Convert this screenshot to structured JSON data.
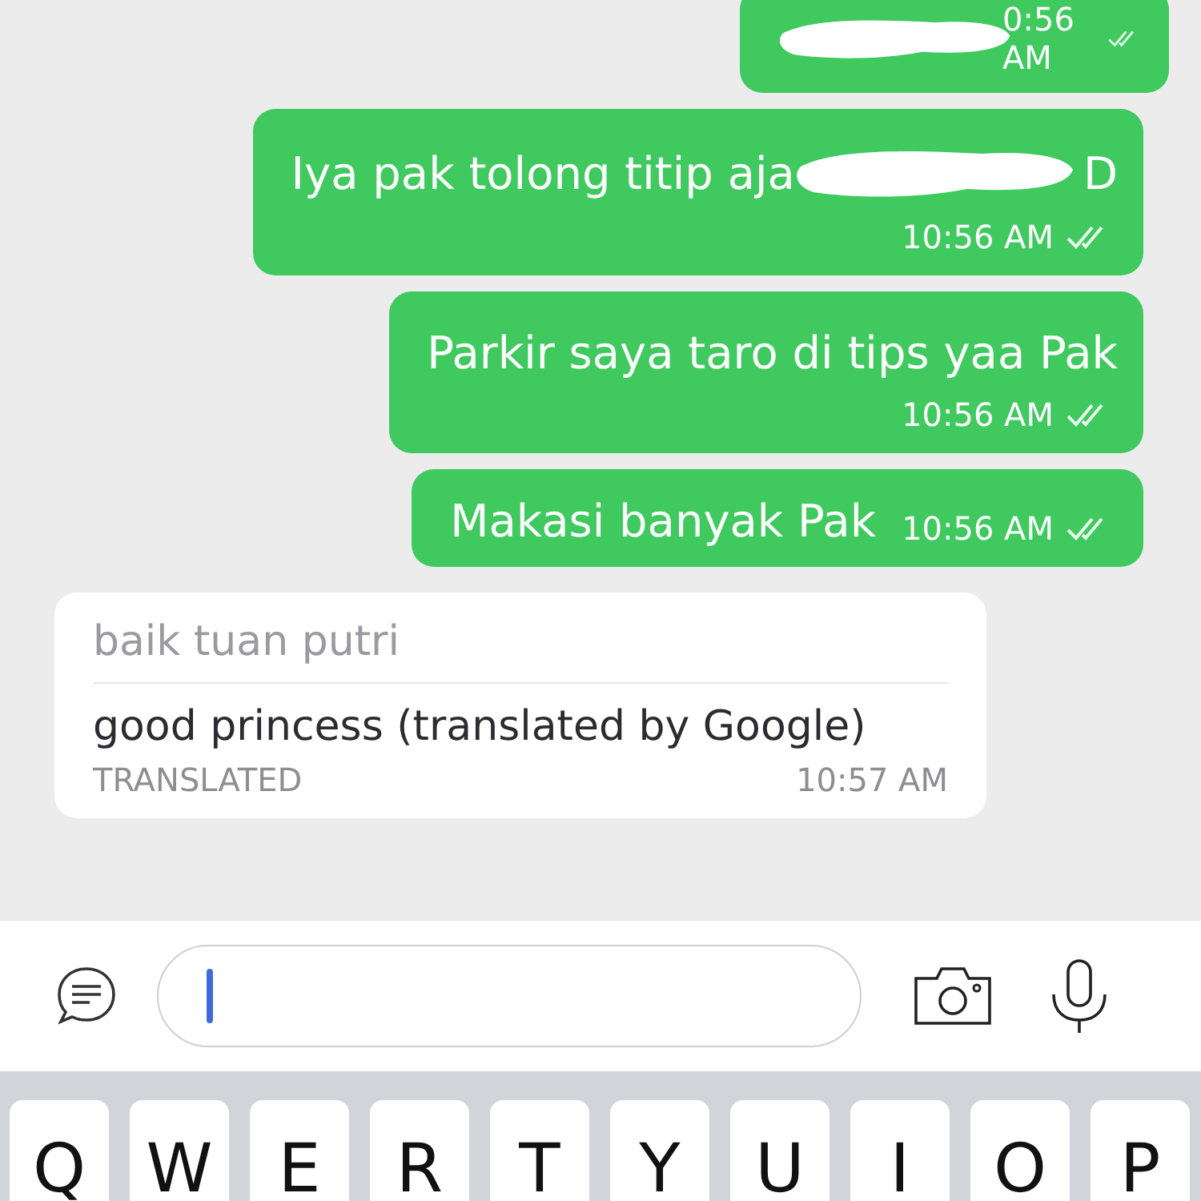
{
  "messages": [
    {
      "kind": "sent",
      "redacted": true,
      "time": "0:56 AM"
    },
    {
      "kind": "sent",
      "redacted": true,
      "text": "Iya pak tolong titip aja",
      "text_after": "D",
      "time": "10:56 AM"
    },
    {
      "kind": "sent",
      "redacted": false,
      "text": "Parkir saya taro di tips yaa Pak",
      "time": "10:56 AM"
    },
    {
      "kind": "sent_short",
      "redacted": false,
      "text": "Makasi banyak Pak",
      "time": "10:56 AM"
    },
    {
      "kind": "received",
      "original": "baik tuan putri",
      "translation": "good princess (translated by Google)",
      "label": "TRANSLATED",
      "time": "10:57 AM"
    }
  ],
  "input_bar": {
    "focused": true
  },
  "keyboard": {
    "keys": [
      "Q",
      "W",
      "E",
      "R",
      "T",
      "Y",
      "U",
      "I",
      "O",
      "P"
    ]
  }
}
